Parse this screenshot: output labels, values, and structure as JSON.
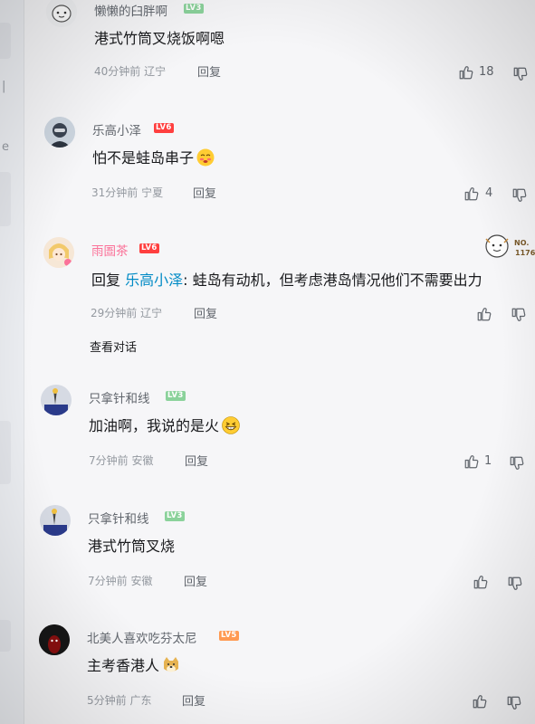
{
  "comments": [
    {
      "username": "懒懒的臼胖啊",
      "level": "LV3",
      "level_color": "#8bd29b",
      "text": "港式竹筒叉烧饭啊嗯",
      "time": "40分钟前",
      "location": "辽宁",
      "reply": "回复",
      "likes": "18"
    },
    {
      "username": "乐高小泽",
      "level": "LV6",
      "level_color": "#ff3f3f",
      "text": "怕不是蛙岛串子",
      "time": "31分钟前",
      "location": "宁夏",
      "reply": "回复",
      "likes": "4"
    },
    {
      "username": "雨圄茶",
      "level": "LV6",
      "level_color": "#ff3f3f",
      "reply_prefix": "回复",
      "reply_target": "乐高小泽",
      "text": ": 蛙岛有动机，但考虑港岛情况他们不需要出力",
      "time": "29分钟前",
      "location": "辽宁",
      "reply": "回复",
      "likes": "",
      "view_conversation": "查看对话",
      "badge_text_top": "NO.",
      "badge_text_num": "1176"
    },
    {
      "username": "只拿针和线",
      "level": "LV3",
      "level_color": "#8bd29b",
      "text": "加油啊，我说的是火",
      "time": "7分钟前",
      "location": "安徽",
      "reply": "回复",
      "likes": "1"
    },
    {
      "username": "只拿针和线",
      "level": "LV3",
      "level_color": "#8bd29b",
      "text": "港式竹筒叉烧",
      "time": "7分钟前",
      "location": "安徽",
      "reply": "回复",
      "likes": ""
    },
    {
      "username": "北美人喜欢吃芬太尼",
      "level": "LV5",
      "level_color": "#ff9a52",
      "text": "主考香港人",
      "time": "5分钟前",
      "location": "广东",
      "reply": "回复",
      "likes": ""
    }
  ],
  "sidebar": {
    "mark_a": "e",
    "mark_b": "|"
  }
}
